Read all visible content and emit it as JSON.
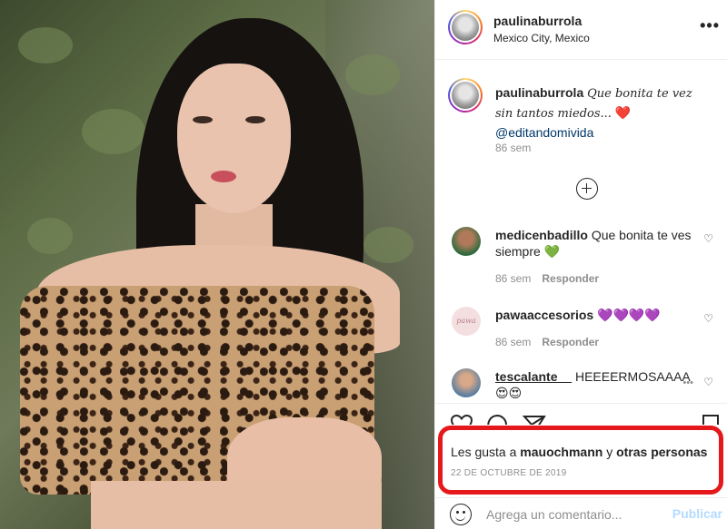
{
  "post": {
    "username": "paulinaburrola",
    "location": "Mexico City, Mexico",
    "more_icon": "more-horizontal-icon",
    "more_label": "•••"
  },
  "caption": {
    "username": "paulinaburrola",
    "text": "Que bonita te vez sin tantos miedos...",
    "heart": "❤️",
    "mention": "@editandomivida",
    "time": "86 sem"
  },
  "load_more_icon": "plus-circle-icon",
  "comments": [
    {
      "username": "medicenbadillo",
      "text": "Que bonita te ves siempre",
      "emoji": "💚",
      "time": "86 sem",
      "reply": "Responder",
      "like_icon": "heart-outline-icon",
      "like_glyph": "♡"
    },
    {
      "username": "pawaaccesorios",
      "text": "",
      "emoji": "💜💜💜💜",
      "time": "86 sem",
      "reply": "Responder",
      "like_icon": "heart-outline-icon",
      "like_glyph": "♡"
    },
    {
      "username": "tescalante__",
      "text": "HEEEERMOSAAAA",
      "emoji": "😍😍",
      "like_icon": "heart-outline-icon",
      "like_glyph": "♡",
      "more_glyph": "•••"
    }
  ],
  "avatar_label": "pawa",
  "likes": {
    "prefix": "Les gusta a",
    "user": "mauochmann",
    "conjunction": "y",
    "others": "otras personas",
    "date": "22 DE OCTUBRE DE 2019"
  },
  "add_comment": {
    "placeholder": "Agrega un comentario...",
    "publish": "Publicar",
    "emoji_icon": "smiley-icon"
  },
  "colors": {
    "highlight_border": "#e5191b",
    "publish_disabled": "#b3dbff",
    "mention": "#00376b"
  }
}
